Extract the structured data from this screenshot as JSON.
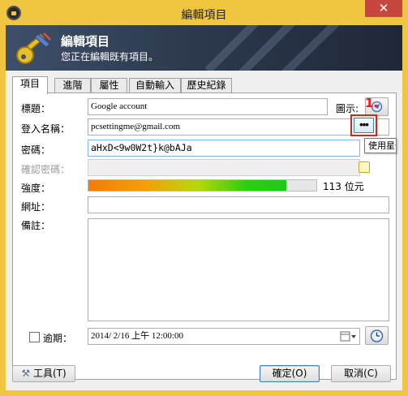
{
  "window": {
    "title": "編輯項目",
    "close_label": "✕",
    "accent": "#f0c540"
  },
  "banner": {
    "title": "編輯項目",
    "subtitle": "您正在編輯既有項目。",
    "icon": "key-icon"
  },
  "tabs": [
    {
      "label": "項目",
      "active": true
    },
    {
      "label": "進階",
      "active": false
    },
    {
      "label": "屬性",
      "active": false
    },
    {
      "label": "自動輸入",
      "active": false
    },
    {
      "label": "歷史紀錄",
      "active": false
    }
  ],
  "form": {
    "title_label": "標題：",
    "title_value": "Google account",
    "icon_label": "圖示:",
    "username_label": "登入名稱：",
    "username_value": "pcsettingme@gmail.com",
    "password_label": "密碼：",
    "password_value": "aHxD<9w0W2t}k@bAJa",
    "show_password_label": "•••",
    "annotation": "1.",
    "tooltip": "使用星號",
    "repeat_label": "確認密碼：",
    "repeat_value": "",
    "quality_label": "強度：",
    "quality_fraction": 0.87,
    "quality_text": "113 位元",
    "url_label": "網址：",
    "url_value": "",
    "notes_label": "備註：",
    "notes_value": "",
    "expires_label": "逾期：",
    "expires_checked": false,
    "expires_value": "2014/  2/16 上午 12:00:00"
  },
  "buttons": {
    "tools": "工具(T)",
    "ok": "確定(O)",
    "cancel": "取消(C)"
  }
}
